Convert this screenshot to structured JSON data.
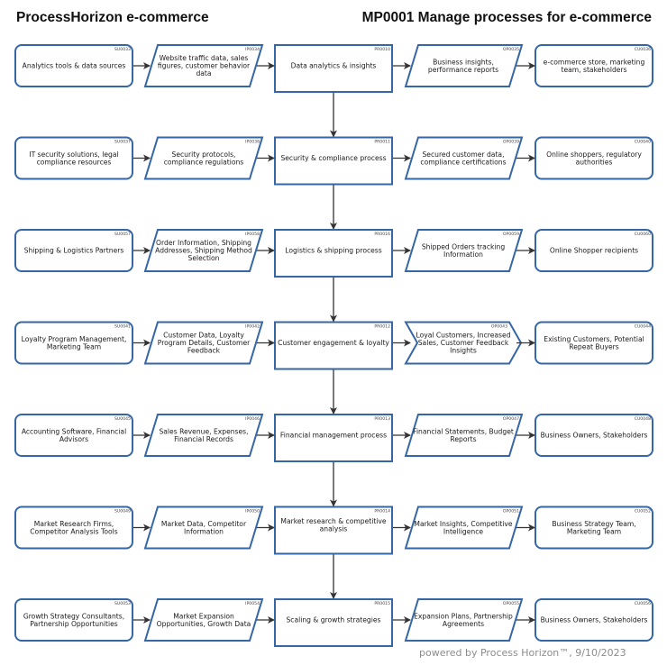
{
  "header": {
    "app_title": "ProcessHorizon e-commerce",
    "process_title": "MP0001 Manage processes for e-commerce"
  },
  "footer": {
    "text": "powered by Process Horizon™, 9/10/2023"
  },
  "colors": {
    "border": "#3566a6",
    "connector": "#333333"
  },
  "rows": [
    {
      "supplier": {
        "id": "SU0033",
        "lines": [
          "Analytics tools & data sources"
        ]
      },
      "input": {
        "id": "IP0034",
        "lines": [
          "Website traffic data, sales",
          "figures, customer behavior",
          "data"
        ]
      },
      "process": {
        "id": "PR0010",
        "lines": [
          "Data analytics & insights"
        ]
      },
      "output": {
        "id": "OP0035",
        "shape": "parallelogram",
        "lines": [
          "Business insights,",
          "performance reports"
        ]
      },
      "customer": {
        "id": "CU0036",
        "lines": [
          "e-commerce store, marketing",
          "team, stakeholders"
        ]
      }
    },
    {
      "supplier": {
        "id": "SU0037",
        "lines": [
          "IT security solutions, legal",
          "compliance resources"
        ]
      },
      "input": {
        "id": "IP0038",
        "lines": [
          "Security protocols,",
          "compliance regulations"
        ]
      },
      "process": {
        "id": "PR0011",
        "lines": [
          "Security & compliance process"
        ]
      },
      "output": {
        "id": "OP0039",
        "shape": "parallelogram",
        "lines": [
          "Secured customer data,",
          "compliance certifications"
        ]
      },
      "customer": {
        "id": "CU0040",
        "lines": [
          "Online shoppers, regulatory",
          "authorities"
        ]
      }
    },
    {
      "supplier": {
        "id": "SU0057",
        "lines": [
          "Shipping & Logistics Partners"
        ]
      },
      "input": {
        "id": "IP0058",
        "lines": [
          "Order Information, Shipping",
          "Addresses, Shipping Method",
          "Selection"
        ]
      },
      "process": {
        "id": "PR0016",
        "lines": [
          "Logistics & shipping process"
        ]
      },
      "output": {
        "id": "OP0059",
        "shape": "parallelogram",
        "lines": [
          "Shipped Orders tracking",
          "Information"
        ]
      },
      "customer": {
        "id": "CU0060",
        "lines": [
          "Online Shopper recipients"
        ]
      }
    },
    {
      "supplier": {
        "id": "SU0041",
        "lines": [
          "Loyalty Program Management,",
          "Marketing Team"
        ]
      },
      "input": {
        "id": "IP0042",
        "lines": [
          "Customer Data, Loyalty",
          "Program Details, Customer",
          "Feedback"
        ]
      },
      "process": {
        "id": "PR0012",
        "lines": [
          "Customer engagement & loyalty"
        ]
      },
      "output": {
        "id": "OP0043",
        "shape": "chevron",
        "lines": [
          "Loyal Customers, Increased",
          "Sales, Customer Feedback",
          "Insights"
        ]
      },
      "customer": {
        "id": "CU0044",
        "lines": [
          "Existing Customers, Potential",
          "Repeat Buyers"
        ]
      }
    },
    {
      "supplier": {
        "id": "SU0045",
        "lines": [
          "Accounting Software, Financial",
          "Advisors"
        ]
      },
      "input": {
        "id": "IP0046",
        "lines": [
          "Sales Revenue, Expenses,",
          "Financial Records"
        ]
      },
      "process": {
        "id": "PR0013",
        "lines": [
          "Financial management process"
        ]
      },
      "output": {
        "id": "OP0047",
        "shape": "parallelogram",
        "lines": [
          "Financial Statements, Budget",
          "Reports"
        ]
      },
      "customer": {
        "id": "CU0048",
        "lines": [
          "Business Owners, Stakeholders"
        ]
      }
    },
    {
      "supplier": {
        "id": "SU0049",
        "lines": [
          "Market Research Firms,",
          "Competitor Analysis Tools"
        ]
      },
      "input": {
        "id": "IP0050",
        "lines": [
          "Market Data, Competitor",
          "Information"
        ]
      },
      "process": {
        "id": "PR0014",
        "lines": [
          "Market research & competitive",
          "analysis"
        ]
      },
      "output": {
        "id": "OP0051",
        "shape": "parallelogram",
        "lines": [
          "Market Insights, Competitive",
          "Intelligence"
        ]
      },
      "customer": {
        "id": "CU0052",
        "lines": [
          "Business Strategy Team,",
          "Marketing Team"
        ]
      }
    },
    {
      "supplier": {
        "id": "SU0053",
        "lines": [
          "Growth Strategy Consultants,",
          "Partnership Opportunities"
        ]
      },
      "input": {
        "id": "IP0054",
        "lines": [
          "Market Expansion",
          "Opportunities, Growth Data"
        ]
      },
      "process": {
        "id": "PR0015",
        "lines": [
          "Scaling & growth strategies"
        ]
      },
      "output": {
        "id": "OP0055",
        "shape": "parallelogram",
        "lines": [
          "Expansion Plans, Partnership",
          "Agreements"
        ]
      },
      "customer": {
        "id": "CU0056",
        "lines": [
          "Business Owners, Stakeholders"
        ]
      }
    }
  ]
}
